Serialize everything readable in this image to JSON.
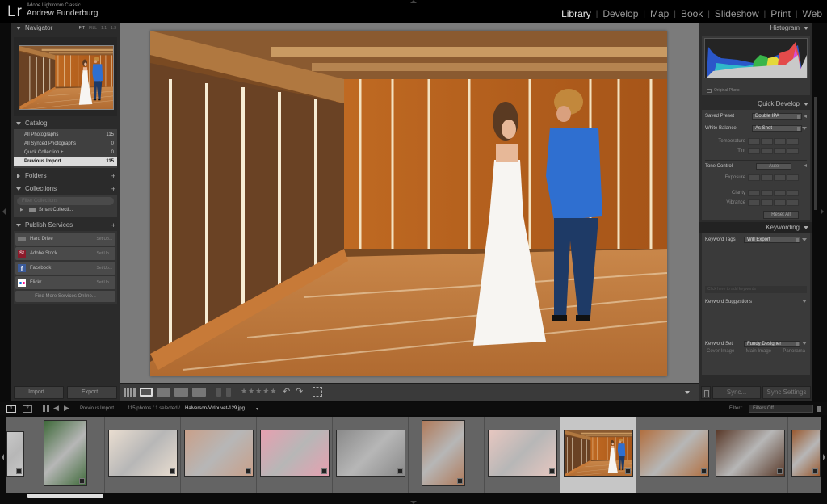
{
  "app": {
    "logo": "Lr",
    "product": "Adobe Lightroom Classic",
    "user": "Andrew Funderburg"
  },
  "modules": [
    {
      "label": "Library",
      "active": true
    },
    {
      "label": "Develop",
      "active": false
    },
    {
      "label": "Map",
      "active": false
    },
    {
      "label": "Book",
      "active": false
    },
    {
      "label": "Slideshow",
      "active": false
    },
    {
      "label": "Print",
      "active": false
    },
    {
      "label": "Web",
      "active": false
    }
  ],
  "left_panel": {
    "navigator": {
      "title": "Navigator",
      "zoom_options": [
        "FIT",
        "FILL",
        "1:1",
        "1:3"
      ]
    },
    "catalog": {
      "title": "Catalog",
      "items": [
        {
          "label": "All Photographs",
          "count": "115"
        },
        {
          "label": "All Synced Photographs",
          "count": "0"
        },
        {
          "label": "Quick Collection +",
          "count": "0"
        },
        {
          "label": "Previous Import",
          "count": "115",
          "selected": true
        }
      ]
    },
    "folders": {
      "title": "Folders"
    },
    "collections": {
      "title": "Collections",
      "filter_placeholder": "Filter Collections",
      "items": [
        {
          "label": "Smart Collecti..."
        }
      ]
    },
    "publish_services": {
      "title": "Publish Services",
      "items": [
        {
          "label": "Hard Drive",
          "action": "Set Up..."
        },
        {
          "label": "Adobe Stock",
          "action": "Set Up...",
          "icon_text": "St"
        },
        {
          "label": "Facebook",
          "action": "Set Up...",
          "icon_text": "f"
        },
        {
          "label": "Flickr",
          "action": "Set Up..."
        }
      ],
      "find_more": "Find More Services Online..."
    },
    "import_label": "Import...",
    "export_label": "Export..."
  },
  "right_panel": {
    "histogram": {
      "title": "Histogram",
      "original_photo": "Original Photo"
    },
    "quick_develop": {
      "title": "Quick Develop",
      "saved_preset_label": "Saved Preset",
      "saved_preset_value": "Double IPA",
      "white_balance_label": "White Balance",
      "white_balance_value": "As Shot",
      "temperature_label": "Temperature",
      "tint_label": "Tint",
      "tone_control_label": "Tone Control",
      "auto_label": "Auto",
      "exposure_label": "Exposure",
      "clarity_label": "Clarity",
      "vibrance_label": "Vibrance",
      "reset_label": "Reset All"
    },
    "keywording": {
      "title": "Keywording",
      "tags_label": "Keyword Tags",
      "tags_value": "Will Export",
      "input_placeholder": "Click here to add keywords",
      "suggestions_label": "Keyword Suggestions",
      "set_label": "Keyword Set",
      "set_value": "Fundy Designer",
      "set_items": [
        "Cover Image",
        "Main Image",
        "Panorama"
      ]
    },
    "sync_label": "Sync...",
    "sync_settings_label": "Sync Settings"
  },
  "toolbar": {
    "rating_stars": "★★★★★"
  },
  "filmstrip_header": {
    "screen1": "1",
    "screen2": "2",
    "source": "Previous Import",
    "status": "115 photos / 1 selected /",
    "filename": "Halverson-Virlouvet-129.jpg",
    "filter_label": "Filter :",
    "filter_value": "Filters Off"
  },
  "filmstrip": {
    "selected_index": 8,
    "thumbs": [
      {
        "subject": "partial"
      },
      {
        "subject": "champagne bottle"
      },
      {
        "subject": "bridal shoes"
      },
      {
        "subject": "bride smiling"
      },
      {
        "subject": "bridesmaids in robes"
      },
      {
        "subject": "black and white bridal party"
      },
      {
        "subject": "champagne toast"
      },
      {
        "subject": "two women in robes"
      },
      {
        "subject": "bride and mother in barn"
      },
      {
        "subject": "bride with bouquet"
      },
      {
        "subject": "couple embracing"
      },
      {
        "subject": "barn interior"
      }
    ]
  }
}
